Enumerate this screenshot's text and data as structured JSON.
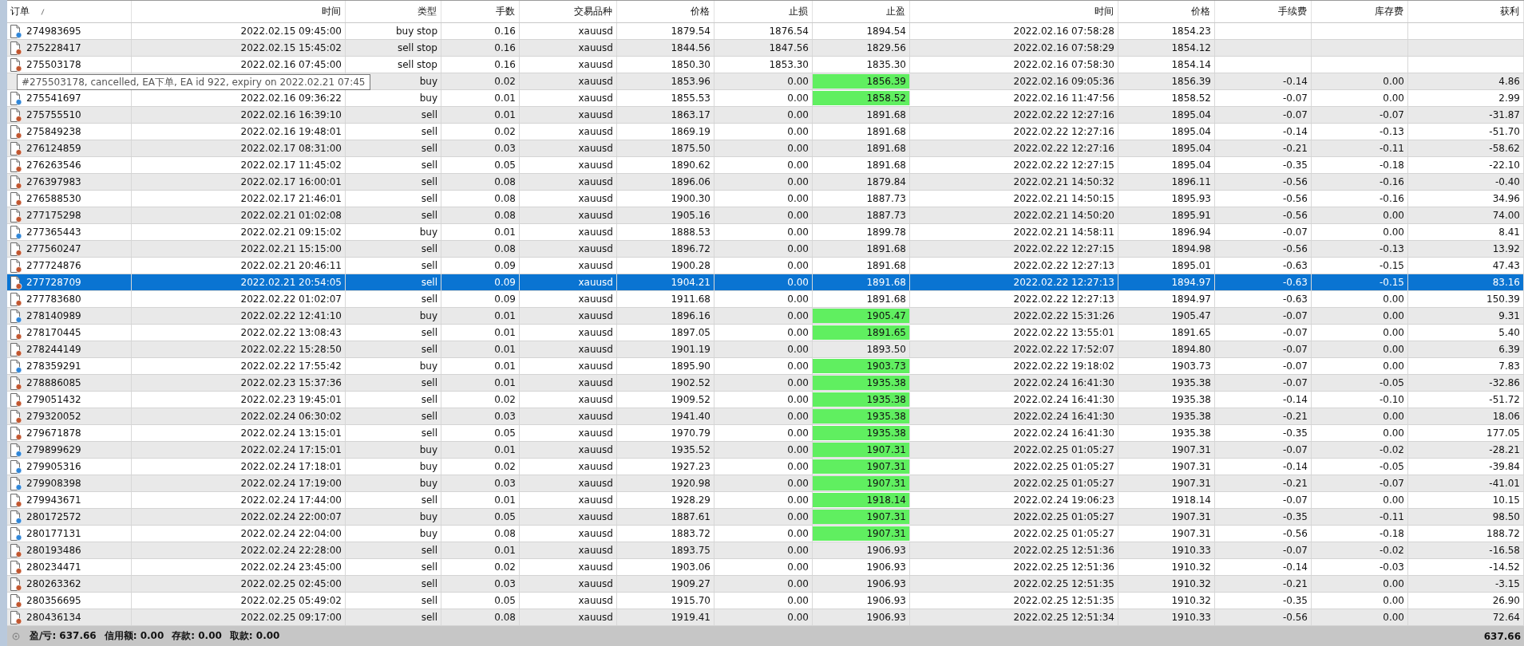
{
  "columns": [
    "订单",
    "时间",
    "类型",
    "手数",
    "交易品种",
    "价格",
    "止损",
    "止盈",
    "时间",
    "价格",
    "手续费",
    "库存费",
    "获利"
  ],
  "sort_mark": true,
  "rows": [
    {
      "kind": "buy",
      "order": "274983695",
      "time": "2022.02.15 09:45:00",
      "type": "buy stop",
      "lots": "0.16",
      "symbol": "xauusd",
      "price": "1879.54",
      "sl": "1876.54",
      "tp": "1894.54",
      "tp_hit": false,
      "close_time": "2022.02.16 07:58:28",
      "close_price": "1854.23",
      "selected": false
    },
    {
      "kind": "sell",
      "order": "275228417",
      "time": "2022.02.15 15:45:02",
      "type": "sell stop",
      "lots": "0.16",
      "symbol": "xauusd",
      "price": "1844.56",
      "sl": "1847.56",
      "tp": "1829.56",
      "tp_hit": false,
      "close_time": "2022.02.16 07:58:29",
      "close_price": "1854.12",
      "selected": false
    },
    {
      "kind": "sell",
      "order": "275503178",
      "time": "2022.02.16 07:45:00",
      "type": "sell stop",
      "lots": "0.16",
      "symbol": "xauusd",
      "price": "1850.30",
      "sl": "1853.30",
      "tp": "1835.30",
      "tp_hit": false,
      "close_time": "2022.02.16 07:58:30",
      "close_price": "1854.14",
      "selected": false
    },
    {
      "type": "buy",
      "lots": "0.02",
      "symbol": "xauusd",
      "price": "1853.96",
      "sl": "0.00",
      "tp": "1856.39",
      "tp_hit": true,
      "close_time": "2022.02.16 09:05:36",
      "close_price": "1856.39",
      "commission": "-0.14",
      "swap": "0.00",
      "profit": "4.86",
      "selected": false
    },
    {
      "kind": "buy",
      "order": "275541697",
      "time": "2022.02.16 09:36:22",
      "type": "buy",
      "lots": "0.01",
      "symbol": "xauusd",
      "price": "1855.53",
      "sl": "0.00",
      "tp": "1858.52",
      "tp_hit": true,
      "close_time": "2022.02.16 11:47:56",
      "close_price": "1858.52",
      "commission": "-0.07",
      "swap": "0.00",
      "profit": "2.99",
      "selected": false
    },
    {
      "kind": "sell",
      "order": "275755510",
      "time": "2022.02.16 16:39:10",
      "type": "sell",
      "lots": "0.01",
      "symbol": "xauusd",
      "price": "1863.17",
      "sl": "0.00",
      "tp": "1891.68",
      "tp_hit": false,
      "close_time": "2022.02.22 12:27:16",
      "close_price": "1895.04",
      "commission": "-0.07",
      "swap": "-0.07",
      "profit": "-31.87",
      "selected": false
    },
    {
      "kind": "sell",
      "order": "275849238",
      "time": "2022.02.16 19:48:01",
      "type": "sell",
      "lots": "0.02",
      "symbol": "xauusd",
      "price": "1869.19",
      "sl": "0.00",
      "tp": "1891.68",
      "tp_hit": false,
      "close_time": "2022.02.22 12:27:16",
      "close_price": "1895.04",
      "commission": "-0.14",
      "swap": "-0.13",
      "profit": "-51.70",
      "selected": false
    },
    {
      "kind": "sell",
      "order": "276124859",
      "time": "2022.02.17 08:31:00",
      "type": "sell",
      "lots": "0.03",
      "symbol": "xauusd",
      "price": "1875.50",
      "sl": "0.00",
      "tp": "1891.68",
      "tp_hit": false,
      "close_time": "2022.02.22 12:27:16",
      "close_price": "1895.04",
      "commission": "-0.21",
      "swap": "-0.11",
      "profit": "-58.62",
      "selected": false
    },
    {
      "kind": "sell",
      "order": "276263546",
      "time": "2022.02.17 11:45:02",
      "type": "sell",
      "lots": "0.05",
      "symbol": "xauusd",
      "price": "1890.62",
      "sl": "0.00",
      "tp": "1891.68",
      "tp_hit": false,
      "close_time": "2022.02.22 12:27:15",
      "close_price": "1895.04",
      "commission": "-0.35",
      "swap": "-0.18",
      "profit": "-22.10",
      "selected": false
    },
    {
      "kind": "sell",
      "order": "276397983",
      "time": "2022.02.17 16:00:01",
      "type": "sell",
      "lots": "0.08",
      "symbol": "xauusd",
      "price": "1896.06",
      "sl": "0.00",
      "tp": "1879.84",
      "tp_hit": false,
      "close_time": "2022.02.21 14:50:32",
      "close_price": "1896.11",
      "commission": "-0.56",
      "swap": "-0.16",
      "profit": "-0.40",
      "selected": false
    },
    {
      "kind": "sell",
      "order": "276588530",
      "time": "2022.02.17 21:46:01",
      "type": "sell",
      "lots": "0.08",
      "symbol": "xauusd",
      "price": "1900.30",
      "sl": "0.00",
      "tp": "1887.73",
      "tp_hit": false,
      "close_time": "2022.02.21 14:50:15",
      "close_price": "1895.93",
      "commission": "-0.56",
      "swap": "-0.16",
      "profit": "34.96",
      "selected": false
    },
    {
      "kind": "sell",
      "order": "277175298",
      "time": "2022.02.21 01:02:08",
      "type": "sell",
      "lots": "0.08",
      "symbol": "xauusd",
      "price": "1905.16",
      "sl": "0.00",
      "tp": "1887.73",
      "tp_hit": false,
      "close_time": "2022.02.21 14:50:20",
      "close_price": "1895.91",
      "commission": "-0.56",
      "swap": "0.00",
      "profit": "74.00",
      "selected": false
    },
    {
      "kind": "buy",
      "order": "277365443",
      "time": "2022.02.21 09:15:02",
      "type": "buy",
      "lots": "0.01",
      "symbol": "xauusd",
      "price": "1888.53",
      "sl": "0.00",
      "tp": "1899.78",
      "tp_hit": false,
      "close_time": "2022.02.21 14:58:11",
      "close_price": "1896.94",
      "commission": "-0.07",
      "swap": "0.00",
      "profit": "8.41",
      "selected": false
    },
    {
      "kind": "sell",
      "order": "277560247",
      "time": "2022.02.21 15:15:00",
      "type": "sell",
      "lots": "0.08",
      "symbol": "xauusd",
      "price": "1896.72",
      "sl": "0.00",
      "tp": "1891.68",
      "tp_hit": false,
      "close_time": "2022.02.22 12:27:15",
      "close_price": "1894.98",
      "commission": "-0.56",
      "swap": "-0.13",
      "profit": "13.92",
      "selected": false
    },
    {
      "kind": "sell",
      "order": "277724876",
      "time": "2022.02.21 20:46:11",
      "type": "sell",
      "lots": "0.09",
      "symbol": "xauusd",
      "price": "1900.28",
      "sl": "0.00",
      "tp": "1891.68",
      "tp_hit": false,
      "close_time": "2022.02.22 12:27:13",
      "close_price": "1895.01",
      "commission": "-0.63",
      "swap": "-0.15",
      "profit": "47.43",
      "selected": false
    },
    {
      "kind": "sell",
      "order": "277728709",
      "time": "2022.02.21 20:54:05",
      "type": "sell",
      "lots": "0.09",
      "symbol": "xauusd",
      "price": "1904.21",
      "sl": "0.00",
      "tp": "1891.68",
      "tp_hit": false,
      "close_time": "2022.02.22 12:27:13",
      "close_price": "1894.97",
      "commission": "-0.63",
      "swap": "-0.15",
      "profit": "83.16",
      "selected": true
    },
    {
      "kind": "sell",
      "order": "277783680",
      "time": "2022.02.22 01:02:07",
      "type": "sell",
      "lots": "0.09",
      "symbol": "xauusd",
      "price": "1911.68",
      "sl": "0.00",
      "tp": "1891.68",
      "tp_hit": false,
      "close_time": "2022.02.22 12:27:13",
      "close_price": "1894.97",
      "commission": "-0.63",
      "swap": "0.00",
      "profit": "150.39",
      "selected": false
    },
    {
      "kind": "buy",
      "order": "278140989",
      "time": "2022.02.22 12:41:10",
      "type": "buy",
      "lots": "0.01",
      "symbol": "xauusd",
      "price": "1896.16",
      "sl": "0.00",
      "tp": "1905.47",
      "tp_hit": true,
      "close_time": "2022.02.22 15:31:26",
      "close_price": "1905.47",
      "commission": "-0.07",
      "swap": "0.00",
      "profit": "9.31",
      "selected": false
    },
    {
      "kind": "sell",
      "order": "278170445",
      "time": "2022.02.22 13:08:43",
      "type": "sell",
      "lots": "0.01",
      "symbol": "xauusd",
      "price": "1897.05",
      "sl": "0.00",
      "tp": "1891.65",
      "tp_hit": true,
      "close_time": "2022.02.22 13:55:01",
      "close_price": "1891.65",
      "commission": "-0.07",
      "swap": "0.00",
      "profit": "5.40",
      "selected": false
    },
    {
      "kind": "sell",
      "order": "278244149",
      "time": "2022.02.22 15:28:50",
      "type": "sell",
      "lots": "0.01",
      "symbol": "xauusd",
      "price": "1901.19",
      "sl": "0.00",
      "tp": "1893.50",
      "tp_hit": false,
      "close_time": "2022.02.22 17:52:07",
      "close_price": "1894.80",
      "commission": "-0.07",
      "swap": "0.00",
      "profit": "6.39",
      "selected": false
    },
    {
      "kind": "buy",
      "order": "278359291",
      "time": "2022.02.22 17:55:42",
      "type": "buy",
      "lots": "0.01",
      "symbol": "xauusd",
      "price": "1895.90",
      "sl": "0.00",
      "tp": "1903.73",
      "tp_hit": true,
      "close_time": "2022.02.22 19:18:02",
      "close_price": "1903.73",
      "commission": "-0.07",
      "swap": "0.00",
      "profit": "7.83",
      "selected": false
    },
    {
      "kind": "sell",
      "order": "278886085",
      "time": "2022.02.23 15:37:36",
      "type": "sell",
      "lots": "0.01",
      "symbol": "xauusd",
      "price": "1902.52",
      "sl": "0.00",
      "tp": "1935.38",
      "tp_hit": true,
      "close_time": "2022.02.24 16:41:30",
      "close_price": "1935.38",
      "commission": "-0.07",
      "swap": "-0.05",
      "profit": "-32.86",
      "selected": false
    },
    {
      "kind": "sell",
      "order": "279051432",
      "time": "2022.02.23 19:45:01",
      "type": "sell",
      "lots": "0.02",
      "symbol": "xauusd",
      "price": "1909.52",
      "sl": "0.00",
      "tp": "1935.38",
      "tp_hit": true,
      "close_time": "2022.02.24 16:41:30",
      "close_price": "1935.38",
      "commission": "-0.14",
      "swap": "-0.10",
      "profit": "-51.72",
      "selected": false
    },
    {
      "kind": "sell",
      "order": "279320052",
      "time": "2022.02.24 06:30:02",
      "type": "sell",
      "lots": "0.03",
      "symbol": "xauusd",
      "price": "1941.40",
      "sl": "0.00",
      "tp": "1935.38",
      "tp_hit": true,
      "close_time": "2022.02.24 16:41:30",
      "close_price": "1935.38",
      "commission": "-0.21",
      "swap": "0.00",
      "profit": "18.06",
      "selected": false
    },
    {
      "kind": "sell",
      "order": "279671878",
      "time": "2022.02.24 13:15:01",
      "type": "sell",
      "lots": "0.05",
      "symbol": "xauusd",
      "price": "1970.79",
      "sl": "0.00",
      "tp": "1935.38",
      "tp_hit": true,
      "close_time": "2022.02.24 16:41:30",
      "close_price": "1935.38",
      "commission": "-0.35",
      "swap": "0.00",
      "profit": "177.05",
      "selected": false
    },
    {
      "kind": "buy",
      "order": "279899629",
      "time": "2022.02.24 17:15:01",
      "type": "buy",
      "lots": "0.01",
      "symbol": "xauusd",
      "price": "1935.52",
      "sl": "0.00",
      "tp": "1907.31",
      "tp_hit": true,
      "close_time": "2022.02.25 01:05:27",
      "close_price": "1907.31",
      "commission": "-0.07",
      "swap": "-0.02",
      "profit": "-28.21",
      "selected": false
    },
    {
      "kind": "buy",
      "order": "279905316",
      "time": "2022.02.24 17:18:01",
      "type": "buy",
      "lots": "0.02",
      "symbol": "xauusd",
      "price": "1927.23",
      "sl": "0.00",
      "tp": "1907.31",
      "tp_hit": true,
      "close_time": "2022.02.25 01:05:27",
      "close_price": "1907.31",
      "commission": "-0.14",
      "swap": "-0.05",
      "profit": "-39.84",
      "selected": false
    },
    {
      "kind": "buy",
      "order": "279908398",
      "time": "2022.02.24 17:19:00",
      "type": "buy",
      "lots": "0.03",
      "symbol": "xauusd",
      "price": "1920.98",
      "sl": "0.00",
      "tp": "1907.31",
      "tp_hit": true,
      "close_time": "2022.02.25 01:05:27",
      "close_price": "1907.31",
      "commission": "-0.21",
      "swap": "-0.07",
      "profit": "-41.01",
      "selected": false
    },
    {
      "kind": "sell",
      "order": "279943671",
      "time": "2022.02.24 17:44:00",
      "type": "sell",
      "lots": "0.01",
      "symbol": "xauusd",
      "price": "1928.29",
      "sl": "0.00",
      "tp": "1918.14",
      "tp_hit": true,
      "close_time": "2022.02.24 19:06:23",
      "close_price": "1918.14",
      "commission": "-0.07",
      "swap": "0.00",
      "profit": "10.15",
      "selected": false
    },
    {
      "kind": "buy",
      "order": "280172572",
      "time": "2022.02.24 22:00:07",
      "type": "buy",
      "lots": "0.05",
      "symbol": "xauusd",
      "price": "1887.61",
      "sl": "0.00",
      "tp": "1907.31",
      "tp_hit": true,
      "close_time": "2022.02.25 01:05:27",
      "close_price": "1907.31",
      "commission": "-0.35",
      "swap": "-0.11",
      "profit": "98.50",
      "selected": false
    },
    {
      "kind": "buy",
      "order": "280177131",
      "time": "2022.02.24 22:04:00",
      "type": "buy",
      "lots": "0.08",
      "symbol": "xauusd",
      "price": "1883.72",
      "sl": "0.00",
      "tp": "1907.31",
      "tp_hit": true,
      "close_time": "2022.02.25 01:05:27",
      "close_price": "1907.31",
      "commission": "-0.56",
      "swap": "-0.18",
      "profit": "188.72",
      "selected": false
    },
    {
      "kind": "sell",
      "order": "280193486",
      "time": "2022.02.24 22:28:00",
      "type": "sell",
      "lots": "0.01",
      "symbol": "xauusd",
      "price": "1893.75",
      "sl": "0.00",
      "tp": "1906.93",
      "tp_hit": false,
      "close_time": "2022.02.25 12:51:36",
      "close_price": "1910.33",
      "commission": "-0.07",
      "swap": "-0.02",
      "profit": "-16.58",
      "selected": false
    },
    {
      "kind": "sell",
      "order": "280234471",
      "time": "2022.02.24 23:45:00",
      "type": "sell",
      "lots": "0.02",
      "symbol": "xauusd",
      "price": "1903.06",
      "sl": "0.00",
      "tp": "1906.93",
      "tp_hit": false,
      "close_time": "2022.02.25 12:51:36",
      "close_price": "1910.32",
      "commission": "-0.14",
      "swap": "-0.03",
      "profit": "-14.52",
      "selected": false
    },
    {
      "kind": "sell",
      "order": "280263362",
      "time": "2022.02.25 02:45:00",
      "type": "sell",
      "lots": "0.03",
      "symbol": "xauusd",
      "price": "1909.27",
      "sl": "0.00",
      "tp": "1906.93",
      "tp_hit": false,
      "close_time": "2022.02.25 12:51:35",
      "close_price": "1910.32",
      "commission": "-0.21",
      "swap": "0.00",
      "profit": "-3.15",
      "selected": false
    },
    {
      "kind": "sell",
      "order": "280356695",
      "time": "2022.02.25 05:49:02",
      "type": "sell",
      "lots": "0.05",
      "symbol": "xauusd",
      "price": "1915.70",
      "sl": "0.00",
      "tp": "1906.93",
      "tp_hit": false,
      "close_time": "2022.02.25 12:51:35",
      "close_price": "1910.32",
      "commission": "-0.35",
      "swap": "0.00",
      "profit": "26.90",
      "selected": false
    },
    {
      "kind": "sell",
      "order": "280436134",
      "time": "2022.02.25 09:17:00",
      "type": "sell",
      "lots": "0.08",
      "symbol": "xauusd",
      "price": "1919.41",
      "sl": "0.00",
      "tp": "1906.93",
      "tp_hit": false,
      "close_time": "2022.02.25 12:51:34",
      "close_price": "1910.33",
      "commission": "-0.56",
      "swap": "0.00",
      "profit": "72.64",
      "selected": false
    }
  ],
  "tooltip": "#275503178, cancelled, EA下单, EA id 922, expiry on 2022.02.21 07:45",
  "footer": {
    "summary": [
      "盈/亏: 637.66",
      "信用额: 0.00",
      "存款: 0.00",
      "取款: 0.00"
    ],
    "total": "637.66"
  }
}
